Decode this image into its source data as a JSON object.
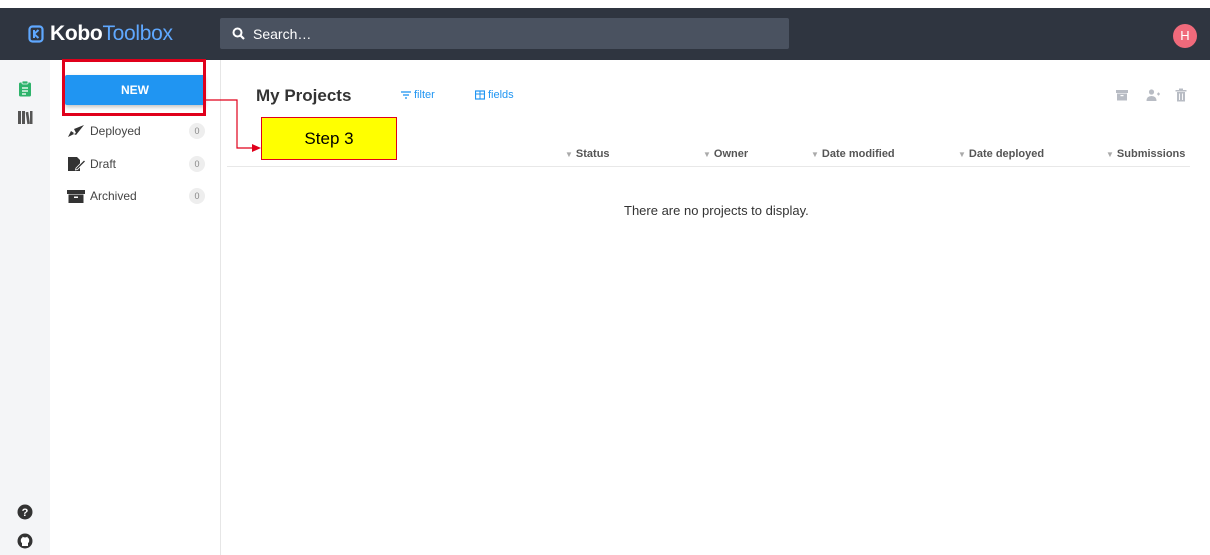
{
  "brand": {
    "name_bold": "Kobo",
    "name_light": "Toolbox"
  },
  "search": {
    "placeholder": "Search…"
  },
  "user": {
    "initial": "H"
  },
  "sidebar": {
    "new_button": "NEW",
    "items": [
      {
        "label": "Deployed",
        "count": "0",
        "icon": "rocket-icon"
      },
      {
        "label": "Draft",
        "count": "0",
        "icon": "draft-icon"
      },
      {
        "label": "Archived",
        "count": "0",
        "icon": "archive-icon"
      }
    ]
  },
  "main": {
    "title": "My Projects",
    "filter_label": "filter",
    "fields_label": "fields",
    "columns": [
      "Status",
      "Owner",
      "Date modified",
      "Date deployed",
      "Submissions"
    ],
    "empty_message": "There are no projects to display."
  },
  "annotation": {
    "label": "Step 3",
    "border_color": "#e0001b",
    "fill_color": "#ffff00"
  },
  "colors": {
    "header": "#2f3540",
    "accent": "#2095f2",
    "avatar": "#f06a7b"
  }
}
